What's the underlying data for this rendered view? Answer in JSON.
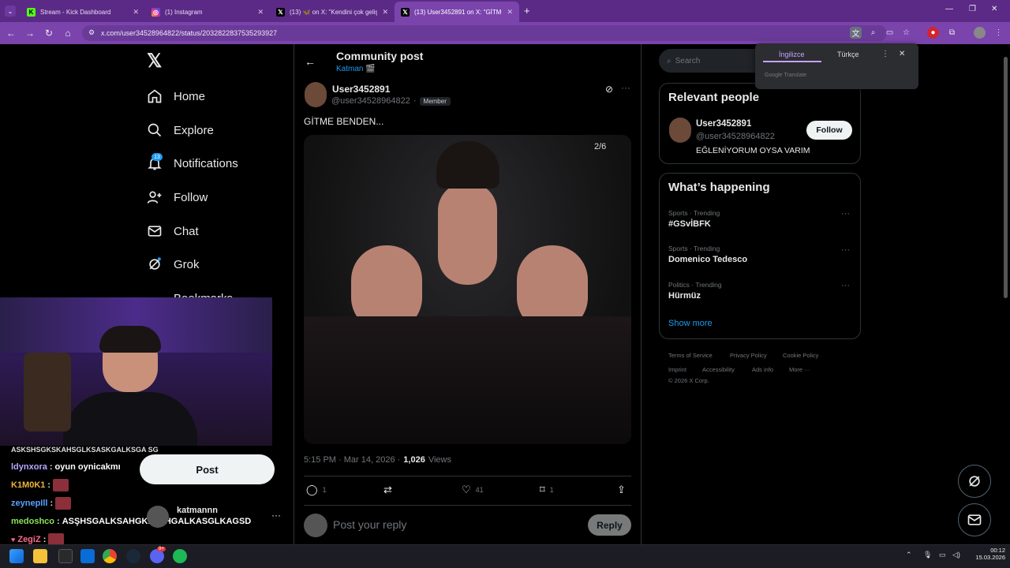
{
  "browser": {
    "tabs": [
      {
        "title": "Stream - Kick Dashboard",
        "icon": "kick-icon"
      },
      {
        "title": "(1) Instagram",
        "icon": "instagram-icon"
      },
      {
        "title": "(13) 🦋 on X: \"Kendini çok geliş",
        "icon": "x-icon"
      },
      {
        "title": "(13) User3452891 on X: \"GİTME",
        "icon": "x-icon"
      }
    ],
    "url": "x.com/user34528964822/status/2032822837535293927"
  },
  "nav": {
    "items": [
      "Home",
      "Explore",
      "Notifications",
      "Follow",
      "Chat",
      "Grok",
      "Bookmarks"
    ],
    "notif_badge": "13",
    "post_button": "Post",
    "account_name": "katmannn"
  },
  "stream_chat": {
    "top_partial": "ASKSHSGKSKAHSGLKSASKGALKSGA SG",
    "lines": [
      {
        "user": "ldynxora",
        "color": "#b9a7ff",
        "text": "oyun oynicakmı",
        "emote": false
      },
      {
        "user": "K1M0K1",
        "color": "#f0b43c",
        "text": "",
        "emote": true
      },
      {
        "user": "zeynepIll",
        "color": "#5aa0ff",
        "text": "",
        "emote": true
      },
      {
        "user": "medoshco",
        "color": "#8be05a",
        "text": "ASŞHSGALKSAHGKLŞSHGALKASGLKAGSD",
        "emote": false
      },
      {
        "user": "ZegiZ",
        "color": "#ff6a8a",
        "text": "",
        "emote": true
      }
    ]
  },
  "post": {
    "header_title": "Community post",
    "community": "Katman 🎬",
    "author_name": "User3452891",
    "author_handle": "@user34528964822",
    "member_label": "Member",
    "text": "GİTME BENDEN...",
    "image_counter": "2/6",
    "time": "5:15 PM · Mar 14, 2026 ·",
    "views_count": "1,026",
    "views_label": "Views",
    "replies": "1",
    "likes": "41",
    "bookmarks": "1",
    "reply_placeholder": "Post your reply",
    "reply_button": "Reply"
  },
  "sidebar": {
    "search_placeholder": "Search",
    "relevant_title": "Relevant people",
    "person_name": "User3452891",
    "person_handle": "@user34528964822",
    "person_bio": "EĞLENİYORUM OYSA VARIM",
    "follow_label": "Follow",
    "happening_title": "What’s happening",
    "trends": [
      {
        "category": "Sports · Trending",
        "name": "#GSvİBFK"
      },
      {
        "category": "Sports · Trending",
        "name": "Domenico Tedesco"
      },
      {
        "category": "Politics · Trending",
        "name": "Hürmüz"
      }
    ],
    "show_more": "Show more",
    "footer": [
      "Terms of Service",
      "Privacy Policy",
      "Cookie Policy",
      "Imprint",
      "Accessibility",
      "Ads info",
      "More ···",
      "© 2026 X Corp."
    ]
  },
  "translate_popup": {
    "tab_english": "İngilizce",
    "tab_turkish": "Türkçe",
    "provider": "Google Translate"
  },
  "taskbar": {
    "time": "00:12",
    "date": "15.03.2026",
    "discord_badge": "9+"
  },
  "colors": {
    "accent": "#1d9bf0",
    "browser_purple": "#7b44ad"
  }
}
